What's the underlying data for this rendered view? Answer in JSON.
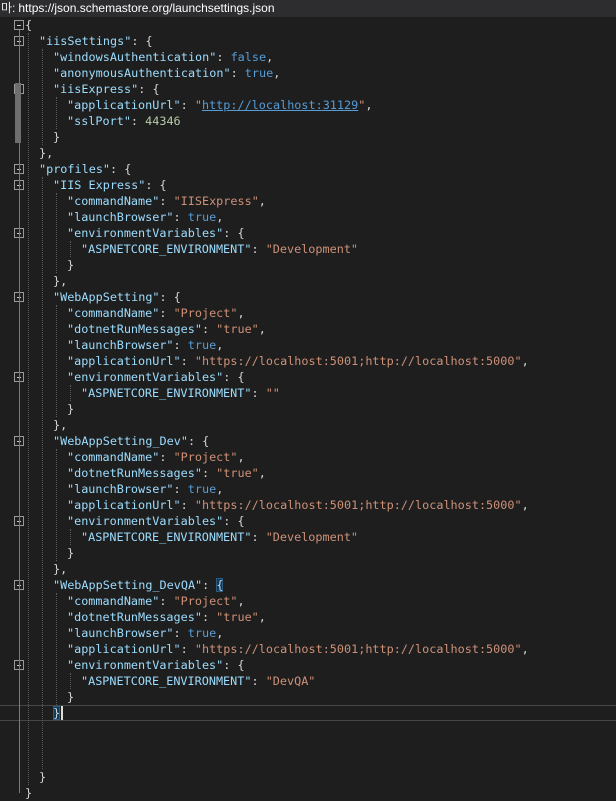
{
  "schema_bar": {
    "prefix": "마:",
    "url": "https://json.schemastore.org/launchsettings.json"
  },
  "colors": {
    "background": "#1e1e1e",
    "key": "#9cdcfe",
    "string": "#ce9178",
    "keyword": "#569cd6",
    "number": "#b5cea8"
  },
  "document": {
    "lines": [
      [
        {
          "t": "p",
          "v": "{"
        }
      ],
      [
        {
          "t": "k",
          "v": "\"iisSettings\""
        },
        {
          "t": "p",
          "v": ": {"
        }
      ],
      [
        {
          "t": "k",
          "v": "\"windowsAuthentication\""
        },
        {
          "t": "p",
          "v": ": "
        },
        {
          "t": "b",
          "v": "false"
        },
        {
          "t": "p",
          "v": ","
        }
      ],
      [
        {
          "t": "k",
          "v": "\"anonymousAuthentication\""
        },
        {
          "t": "p",
          "v": ": "
        },
        {
          "t": "b",
          "v": "true"
        },
        {
          "t": "p",
          "v": ","
        }
      ],
      [
        {
          "t": "k",
          "v": "\"iisExpress\""
        },
        {
          "t": "p",
          "v": ": {"
        }
      ],
      [
        {
          "t": "k",
          "v": "\"applicationUrl\""
        },
        {
          "t": "p",
          "v": ": "
        },
        {
          "t": "s",
          "v": "\""
        },
        {
          "t": "u",
          "v": "http://localhost:31129"
        },
        {
          "t": "s",
          "v": "\""
        },
        {
          "t": "p",
          "v": ","
        }
      ],
      [
        {
          "t": "k",
          "v": "\"sslPort\""
        },
        {
          "t": "p",
          "v": ": "
        },
        {
          "t": "n",
          "v": "44346"
        }
      ],
      [
        {
          "t": "p",
          "v": "}"
        }
      ],
      [
        {
          "t": "p",
          "v": "},"
        }
      ],
      [
        {
          "t": "k",
          "v": "\"profiles\""
        },
        {
          "t": "p",
          "v": ": {"
        }
      ],
      [
        {
          "t": "k",
          "v": "\"IIS Express\""
        },
        {
          "t": "p",
          "v": ": {"
        }
      ],
      [
        {
          "t": "k",
          "v": "\"commandName\""
        },
        {
          "t": "p",
          "v": ": "
        },
        {
          "t": "s",
          "v": "\"IISExpress\""
        },
        {
          "t": "p",
          "v": ","
        }
      ],
      [
        {
          "t": "k",
          "v": "\"launchBrowser\""
        },
        {
          "t": "p",
          "v": ": "
        },
        {
          "t": "b",
          "v": "true"
        },
        {
          "t": "p",
          "v": ","
        }
      ],
      [
        {
          "t": "k",
          "v": "\"environmentVariables\""
        },
        {
          "t": "p",
          "v": ": {"
        }
      ],
      [
        {
          "t": "k",
          "v": "\"ASPNETCORE_ENVIRONMENT\""
        },
        {
          "t": "p",
          "v": ": "
        },
        {
          "t": "s",
          "v": "\"Development\""
        }
      ],
      [
        {
          "t": "p",
          "v": "}"
        }
      ],
      [
        {
          "t": "p",
          "v": "},"
        }
      ],
      [
        {
          "t": "k",
          "v": "\"WebAppSetting\""
        },
        {
          "t": "p",
          "v": ": {"
        }
      ],
      [
        {
          "t": "k",
          "v": "\"commandName\""
        },
        {
          "t": "p",
          "v": ": "
        },
        {
          "t": "s",
          "v": "\"Project\""
        },
        {
          "t": "p",
          "v": ","
        }
      ],
      [
        {
          "t": "k",
          "v": "\"dotnetRunMessages\""
        },
        {
          "t": "p",
          "v": ": "
        },
        {
          "t": "s",
          "v": "\"true\""
        },
        {
          "t": "p",
          "v": ","
        }
      ],
      [
        {
          "t": "k",
          "v": "\"launchBrowser\""
        },
        {
          "t": "p",
          "v": ": "
        },
        {
          "t": "b",
          "v": "true"
        },
        {
          "t": "p",
          "v": ","
        }
      ],
      [
        {
          "t": "k",
          "v": "\"applicationUrl\""
        },
        {
          "t": "p",
          "v": ": "
        },
        {
          "t": "s",
          "v": "\"https://localhost:5001;http://localhost:5000\""
        },
        {
          "t": "p",
          "v": ","
        }
      ],
      [
        {
          "t": "k",
          "v": "\"environmentVariables\""
        },
        {
          "t": "p",
          "v": ": {"
        }
      ],
      [
        {
          "t": "k",
          "v": "\"ASPNETCORE_ENVIRONMENT\""
        },
        {
          "t": "p",
          "v": ": "
        },
        {
          "t": "s",
          "v": "\"\""
        }
      ],
      [
        {
          "t": "p",
          "v": "}"
        }
      ],
      [
        {
          "t": "p",
          "v": "},"
        }
      ],
      [
        {
          "t": "k",
          "v": "\"WebAppSetting_Dev\""
        },
        {
          "t": "p",
          "v": ": {"
        }
      ],
      [
        {
          "t": "k",
          "v": "\"commandName\""
        },
        {
          "t": "p",
          "v": ": "
        },
        {
          "t": "s",
          "v": "\"Project\""
        },
        {
          "t": "p",
          "v": ","
        }
      ],
      [
        {
          "t": "k",
          "v": "\"dotnetRunMessages\""
        },
        {
          "t": "p",
          "v": ": "
        },
        {
          "t": "s",
          "v": "\"true\""
        },
        {
          "t": "p",
          "v": ","
        }
      ],
      [
        {
          "t": "k",
          "v": "\"launchBrowser\""
        },
        {
          "t": "p",
          "v": ": "
        },
        {
          "t": "b",
          "v": "true"
        },
        {
          "t": "p",
          "v": ","
        }
      ],
      [
        {
          "t": "k",
          "v": "\"applicationUrl\""
        },
        {
          "t": "p",
          "v": ": "
        },
        {
          "t": "s",
          "v": "\"https://localhost:5001;http://localhost:5000\""
        },
        {
          "t": "p",
          "v": ","
        }
      ],
      [
        {
          "t": "k",
          "v": "\"environmentVariables\""
        },
        {
          "t": "p",
          "v": ": {"
        }
      ],
      [
        {
          "t": "k",
          "v": "\"ASPNETCORE_ENVIRONMENT\""
        },
        {
          "t": "p",
          "v": ": "
        },
        {
          "t": "s",
          "v": "\"Development\""
        }
      ],
      [
        {
          "t": "p",
          "v": "}"
        }
      ],
      [
        {
          "t": "p",
          "v": "},"
        }
      ],
      [
        {
          "t": "k",
          "v": "\"WebAppSetting_DevQA\""
        },
        {
          "t": "p",
          "v": ": "
        },
        {
          "t": "bm",
          "v": "{"
        }
      ],
      [
        {
          "t": "k",
          "v": "\"commandName\""
        },
        {
          "t": "p",
          "v": ": "
        },
        {
          "t": "s",
          "v": "\"Project\""
        },
        {
          "t": "p",
          "v": ","
        }
      ],
      [
        {
          "t": "k",
          "v": "\"dotnetRunMessages\""
        },
        {
          "t": "p",
          "v": ": "
        },
        {
          "t": "s",
          "v": "\"true\""
        },
        {
          "t": "p",
          "v": ","
        }
      ],
      [
        {
          "t": "k",
          "v": "\"launchBrowser\""
        },
        {
          "t": "p",
          "v": ": "
        },
        {
          "t": "b",
          "v": "true"
        },
        {
          "t": "p",
          "v": ","
        }
      ],
      [
        {
          "t": "k",
          "v": "\"applicationUrl\""
        },
        {
          "t": "p",
          "v": ": "
        },
        {
          "t": "s",
          "v": "\"https://localhost:5001;http://localhost:5000\""
        },
        {
          "t": "p",
          "v": ","
        }
      ],
      [
        {
          "t": "k",
          "v": "\"environmentVariables\""
        },
        {
          "t": "p",
          "v": ": {"
        }
      ],
      [
        {
          "t": "k",
          "v": "\"ASPNETCORE_ENVIRONMENT\""
        },
        {
          "t": "p",
          "v": ": "
        },
        {
          "t": "s",
          "v": "\"DevQA\""
        }
      ],
      [
        {
          "t": "p",
          "v": "}"
        }
      ],
      [
        {
          "t": "bm",
          "v": "}"
        }
      ],
      [],
      [],
      [],
      [
        {
          "t": "p",
          "v": "}"
        }
      ],
      [
        {
          "t": "p",
          "v": "}"
        }
      ]
    ]
  }
}
